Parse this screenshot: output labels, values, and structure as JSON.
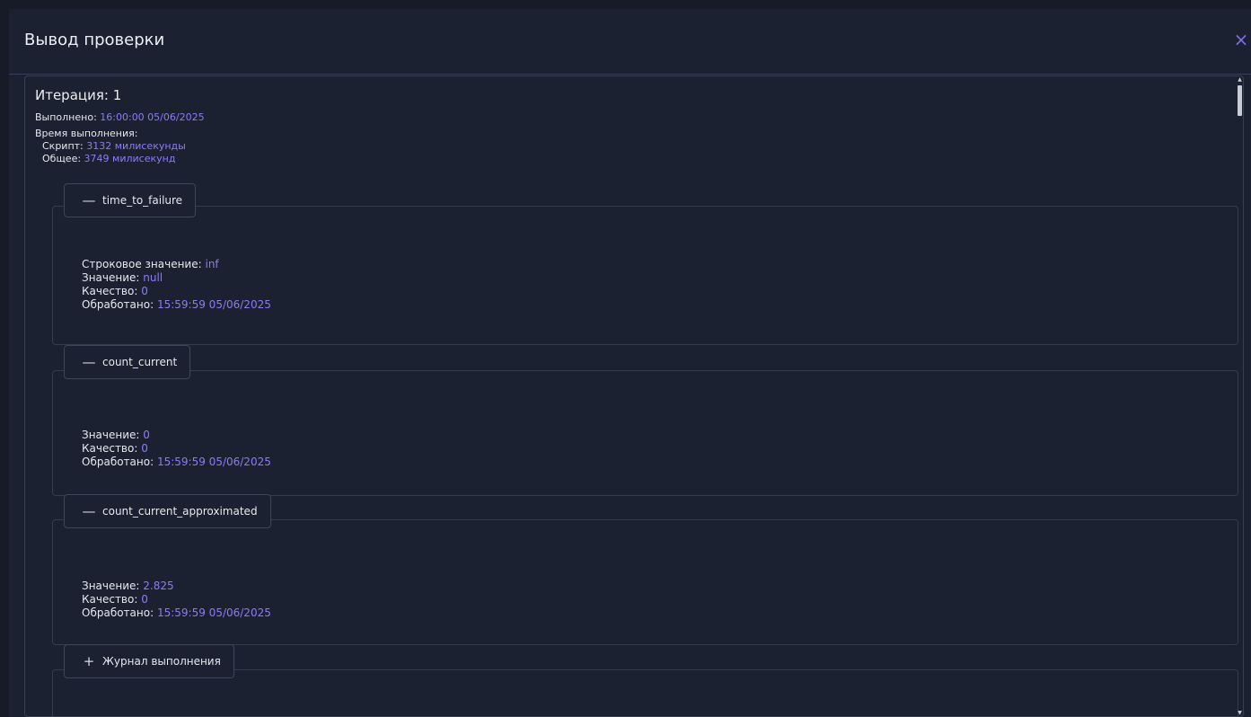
{
  "dialog": {
    "title": "Вывод проверки",
    "close_symbol": "×"
  },
  "iteration": {
    "title": "Итерация: 1",
    "executed_label": "Выполнено:",
    "executed_value": "16:00:00 05/06/2025",
    "exec_time_label": "Время выполнения:",
    "script_label": "Скрипт:",
    "script_value": "3132 милисекунды",
    "total_label": "Общее:",
    "total_value": "3749 милисекунд"
  },
  "groups": [
    {
      "name": "time_to_failure",
      "toggle": "—",
      "fields": [
        {
          "label": "Строковое значение:",
          "value": "inf"
        },
        {
          "label": "Значение:",
          "value": "null"
        },
        {
          "label": "Качество:",
          "value": "0"
        },
        {
          "label": "Обработано:",
          "value": "15:59:59 05/06/2025"
        }
      ]
    },
    {
      "name": "count_current",
      "toggle": "—",
      "fields": [
        {
          "label": "Значение:",
          "value": "0"
        },
        {
          "label": "Качество:",
          "value": "0"
        },
        {
          "label": "Обработано:",
          "value": "15:59:59 05/06/2025"
        }
      ]
    },
    {
      "name": "count_current_approximated",
      "toggle": "—",
      "fields": [
        {
          "label": "Значение:",
          "value": "2.825"
        },
        {
          "label": "Качество:",
          "value": "0"
        },
        {
          "label": "Обработано:",
          "value": "15:59:59 05/06/2025"
        }
      ]
    },
    {
      "name": "Журнал выполнения",
      "toggle": "+",
      "fields": []
    }
  ],
  "colors": {
    "background": "#1b2130",
    "accent": "#8b7cf6",
    "border": "#363c4e"
  },
  "icons": {
    "close": "close-icon",
    "collapse": "minus-icon",
    "expand": "plus-icon"
  }
}
